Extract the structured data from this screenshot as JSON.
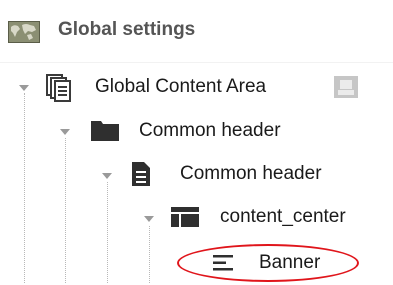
{
  "header": {
    "title": "Global settings",
    "icon": "world-map-icon"
  },
  "tree": {
    "nodes": [
      {
        "label": "Global Content Area",
        "icon": "pages-stack-icon",
        "expanded": true,
        "badge_icon": "placeholder-icon"
      },
      {
        "label": "Common header",
        "icon": "folder-icon",
        "expanded": true
      },
      {
        "label": "Common header",
        "icon": "document-icon",
        "expanded": true
      },
      {
        "label": "content_center",
        "icon": "layout-icon",
        "expanded": true
      },
      {
        "label": "Banner",
        "icon": "text-lines-icon",
        "expanded": false,
        "highlighted": true
      }
    ]
  },
  "colors": {
    "header_text": "#555555",
    "icon_dark": "#2f2f2f",
    "highlight": "#e0151b",
    "tree_lines": "#b8b8b8"
  }
}
